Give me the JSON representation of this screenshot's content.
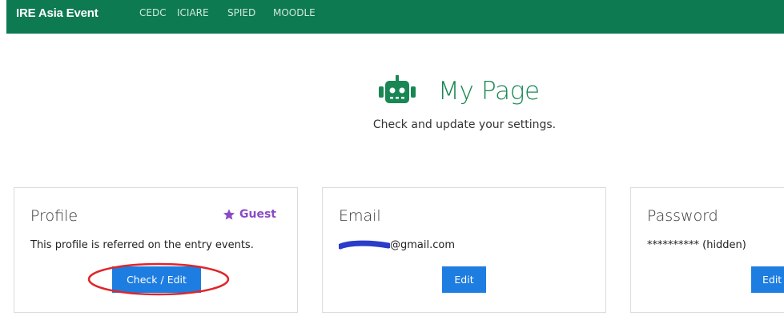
{
  "navbar": {
    "brand": "IRE Asia Event",
    "links": [
      "CEDC",
      "ICIARE",
      "SPIED",
      "MOODLE"
    ]
  },
  "hero": {
    "icon": "robot-icon",
    "title": "My Page",
    "subtitle": "Check and update your settings."
  },
  "cards": {
    "profile": {
      "title": "Profile",
      "badge": "Guest",
      "badge_icon": "star-icon",
      "text": "This profile is referred on the entry events.",
      "button": "Check / Edit"
    },
    "email": {
      "title": "Email",
      "value": "@gmail.com",
      "button": "Edit"
    },
    "password": {
      "title": "Password",
      "value": "********** (hidden)",
      "button": "Edit"
    }
  },
  "colors": {
    "navbar": "#0d7a52",
    "accent": "#198754",
    "button": "#1e7de0",
    "badge": "#8a4bc8",
    "annotation": "#e0252a",
    "redaction": "#2b3cc9"
  }
}
